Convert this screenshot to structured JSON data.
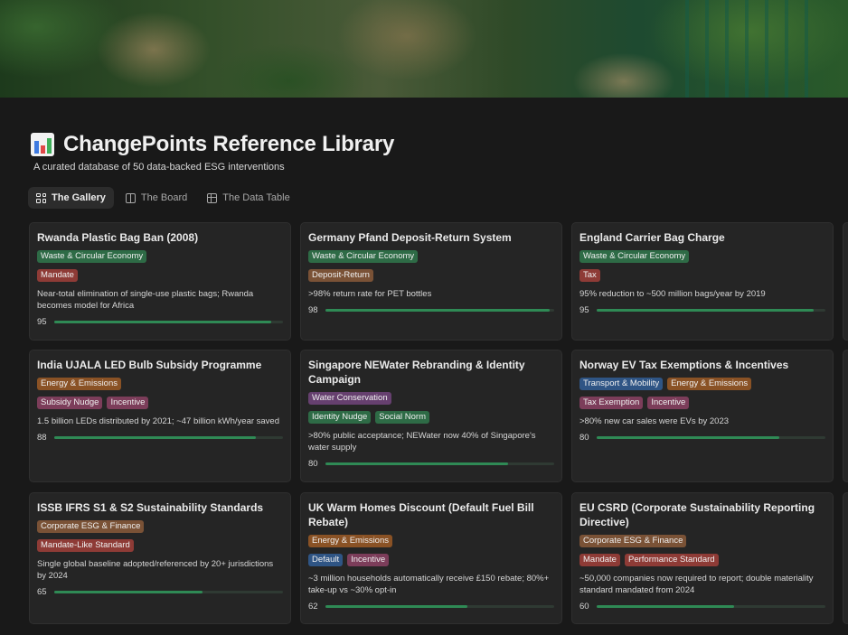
{
  "page": {
    "title": "ChangePoints Reference Library",
    "title_icon": "bar-chart-emoji-icon",
    "subtitle": "A curated database of 50 data-backed ESG interventions"
  },
  "tabs": [
    {
      "label": "The Gallery",
      "icon": "gallery-grid-icon",
      "active": true
    },
    {
      "label": "The Board",
      "icon": "board-columns-icon",
      "active": false
    },
    {
      "label": "The Data Table",
      "icon": "table-icon",
      "active": false
    }
  ],
  "tag_colors": {
    "green": "#2e6b46",
    "red": "#8e3b36",
    "brown": "#7a5236",
    "orange": "#8a5225",
    "pink": "#7c3d5a",
    "purple": "#66406f",
    "blue": "#2f5585",
    "progress": "#2f8a55"
  },
  "cards": [
    {
      "title": "Rwanda Plastic Bag Ban (2008)",
      "tags1": [
        {
          "label": "Waste & Circular Economy",
          "color": "green"
        }
      ],
      "tags2": [
        {
          "label": "Mandate",
          "color": "red"
        }
      ],
      "desc": "Near-total elimination of single-use plastic bags; Rwanda becomes model for Africa",
      "score": "95"
    },
    {
      "title": "Germany Pfand Deposit-Return System",
      "tags1": [
        {
          "label": "Waste & Circular Economy",
          "color": "green"
        }
      ],
      "tags2": [
        {
          "label": "Deposit-Return",
          "color": "brown"
        }
      ],
      "desc": ">98% return rate for PET bottles",
      "score": "98"
    },
    {
      "title": "England Carrier Bag Charge",
      "tags1": [
        {
          "label": "Waste & Circular Economy",
          "color": "green"
        }
      ],
      "tags2": [
        {
          "label": "Tax",
          "color": "red"
        }
      ],
      "desc": "95% reduction to ~500 million bags/year by 2019",
      "score": "95"
    },
    {
      "title": "India UJALA LED Bulb Subsidy Programme",
      "tags1": [
        {
          "label": "Energy & Emissions",
          "color": "orange"
        }
      ],
      "tags2": [
        {
          "label": "Subsidy Nudge",
          "color": "pink"
        },
        {
          "label": "Incentive",
          "color": "pink"
        }
      ],
      "desc": "1.5 billion LEDs distributed by 2021; ~47 billion kWh/year saved",
      "score": "88"
    },
    {
      "title": "Singapore NEWater Rebranding & Identity Campaign",
      "tags1": [
        {
          "label": "Water Conservation",
          "color": "purple"
        }
      ],
      "tags2": [
        {
          "label": "Identity Nudge",
          "color": "green"
        },
        {
          "label": "Social Norm",
          "color": "green"
        }
      ],
      "desc": ">80% public acceptance; NEWater now 40% of Singapore's water supply",
      "score": "80"
    },
    {
      "title": "Norway EV Tax Exemptions & Incentives",
      "tags1": [
        {
          "label": "Transport & Mobility",
          "color": "blue"
        },
        {
          "label": "Energy & Emissions",
          "color": "orange"
        }
      ],
      "tags2": [
        {
          "label": "Tax Exemption",
          "color": "pink"
        },
        {
          "label": "Incentive",
          "color": "pink"
        }
      ],
      "desc": ">80% new car sales were EVs by 2023",
      "score": "80"
    },
    {
      "title": "ISSB IFRS S1 & S2 Sustainability Standards",
      "tags1": [
        {
          "label": "Corporate ESG & Finance",
          "color": "brown"
        }
      ],
      "tags2": [
        {
          "label": "Mandate-Like Standard",
          "color": "red"
        }
      ],
      "desc": "Single global baseline adopted/referenced by 20+ jurisdictions by 2024",
      "score": "65"
    },
    {
      "title": "UK Warm Homes Discount (Default Fuel Bill Rebate)",
      "tags1": [
        {
          "label": "Energy & Emissions",
          "color": "orange"
        }
      ],
      "tags2": [
        {
          "label": "Default",
          "color": "blue"
        },
        {
          "label": "Incentive",
          "color": "pink"
        }
      ],
      "desc": "~3 million households automatically receive £150 rebate; 80%+ take-up vs ~30% opt-in",
      "score": "62"
    },
    {
      "title": "EU CSRD (Corporate Sustainability Reporting Directive)",
      "tags1": [
        {
          "label": "Corporate ESG & Finance",
          "color": "brown"
        }
      ],
      "tags2": [
        {
          "label": "Mandate",
          "color": "red"
        },
        {
          "label": "Performance Standard",
          "color": "red"
        }
      ],
      "desc": "~50,000 companies now required to report; double materiality standard mandated from 2024",
      "score": "60"
    }
  ]
}
